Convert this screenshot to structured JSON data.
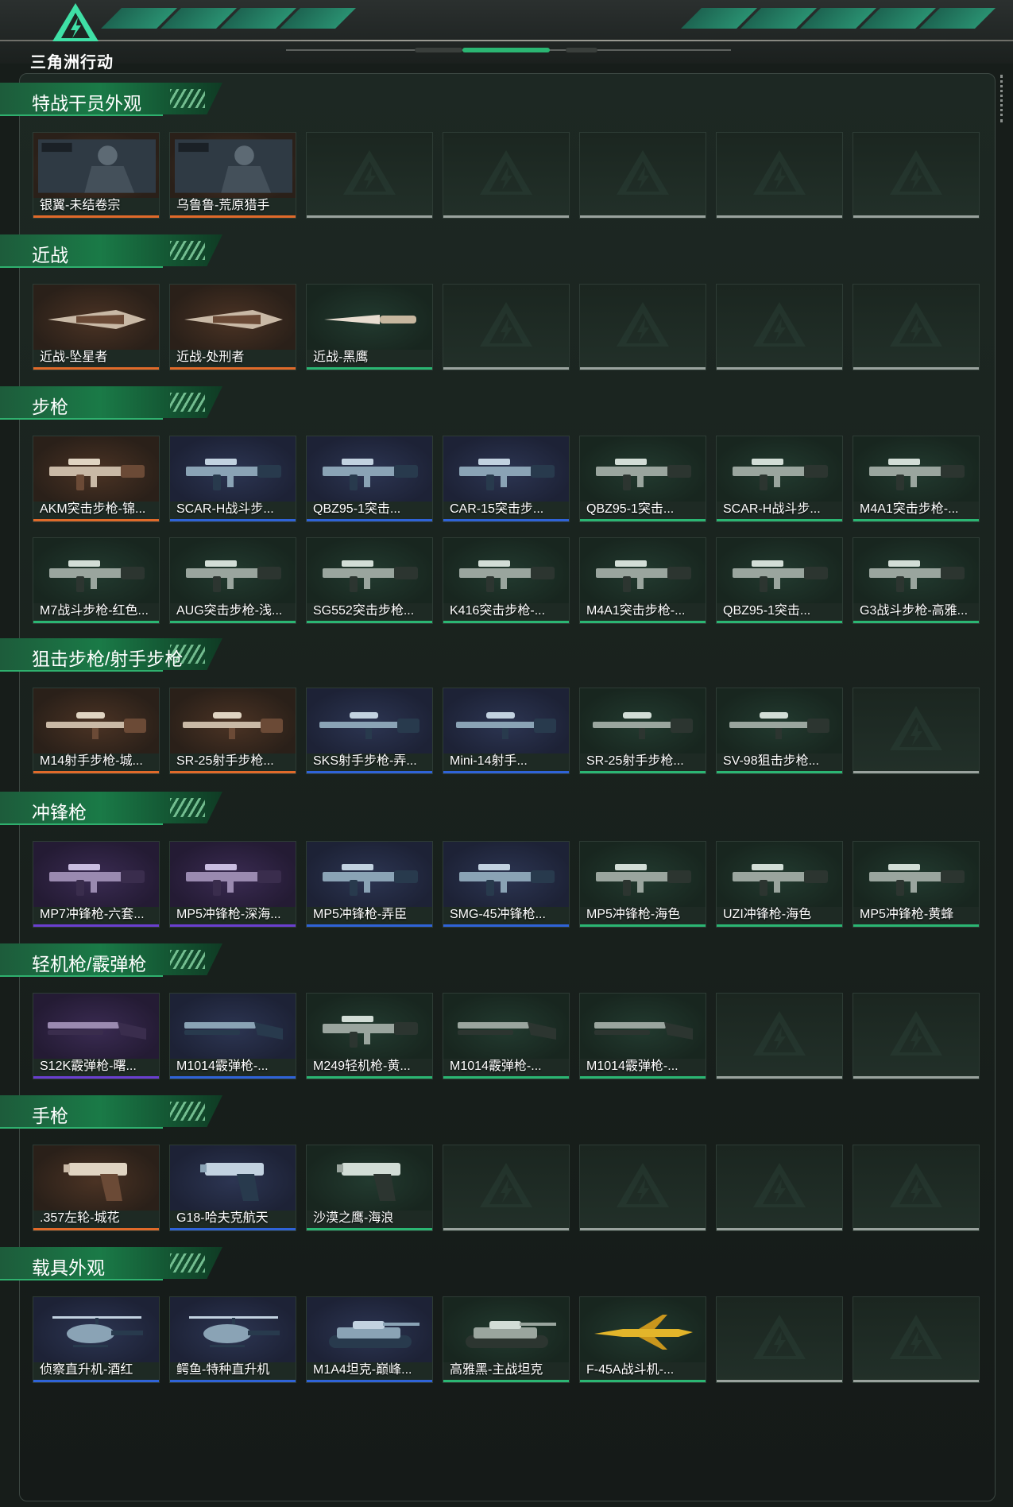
{
  "brand": {
    "logo_text": "三角洲行动"
  },
  "colors": {
    "orange": "#e06a2a",
    "blue": "#2f63d8",
    "purple": "#6a3fd0",
    "green": "#2bb673",
    "empty": "#9aa39e"
  },
  "sections": [
    {
      "title": "特战干员外观",
      "items": [
        {
          "label": "银翼-未结卷宗",
          "tier": "orange",
          "icon": "operator-portrait"
        },
        {
          "label": "乌鲁鲁-荒原猎手",
          "tier": "orange",
          "icon": "operator-portrait"
        },
        {
          "label": "",
          "tier": "empty"
        },
        {
          "label": "",
          "tier": "empty"
        },
        {
          "label": "",
          "tier": "empty"
        },
        {
          "label": "",
          "tier": "empty"
        },
        {
          "label": "",
          "tier": "empty"
        }
      ]
    },
    {
      "title": "近战",
      "items": [
        {
          "label": "近战-坠星者",
          "tier": "orange",
          "icon": "blade"
        },
        {
          "label": "近战-处刑者",
          "tier": "orange",
          "icon": "blade"
        },
        {
          "label": "近战-黑鹰",
          "tier": "green",
          "icon": "knife"
        },
        {
          "label": "",
          "tier": "empty"
        },
        {
          "label": "",
          "tier": "empty"
        },
        {
          "label": "",
          "tier": "empty"
        },
        {
          "label": "",
          "tier": "empty"
        }
      ]
    },
    {
      "title": "步枪",
      "items": [
        {
          "label": "AKM突击步枪-锦...",
          "tier": "orange",
          "icon": "rifle"
        },
        {
          "label": "SCAR-H战斗步...",
          "tier": "blue",
          "icon": "rifle"
        },
        {
          "label": "QBZ95-1突击...",
          "tier": "blue",
          "icon": "rifle"
        },
        {
          "label": "CAR-15突击步...",
          "tier": "blue",
          "icon": "rifle"
        },
        {
          "label": "QBZ95-1突击...",
          "tier": "green",
          "icon": "rifle"
        },
        {
          "label": "SCAR-H战斗步...",
          "tier": "green",
          "icon": "rifle"
        },
        {
          "label": "M4A1突击步枪-...",
          "tier": "green",
          "icon": "rifle"
        },
        {
          "label": "M7战斗步枪-红色...",
          "tier": "green",
          "icon": "rifle"
        },
        {
          "label": "AUG突击步枪-浅...",
          "tier": "green",
          "icon": "rifle"
        },
        {
          "label": "SG552突击步枪...",
          "tier": "green",
          "icon": "rifle"
        },
        {
          "label": "K416突击步枪-...",
          "tier": "green",
          "icon": "rifle"
        },
        {
          "label": "M4A1突击步枪-...",
          "tier": "green",
          "icon": "rifle"
        },
        {
          "label": "QBZ95-1突击...",
          "tier": "green",
          "icon": "rifle"
        },
        {
          "label": "G3战斗步枪-高雅...",
          "tier": "green",
          "icon": "rifle"
        }
      ]
    },
    {
      "title": "狙击步枪/射手步枪",
      "items": [
        {
          "label": "M14射手步枪-城...",
          "tier": "orange",
          "icon": "sniper"
        },
        {
          "label": "SR-25射手步枪...",
          "tier": "orange",
          "icon": "sniper"
        },
        {
          "label": "SKS射手步枪-弄...",
          "tier": "blue",
          "icon": "sniper"
        },
        {
          "label": "Mini-14射手...",
          "tier": "blue",
          "icon": "sniper"
        },
        {
          "label": "SR-25射手步枪...",
          "tier": "green",
          "icon": "sniper"
        },
        {
          "label": "SV-98狙击步枪...",
          "tier": "green",
          "icon": "sniper"
        },
        {
          "label": "",
          "tier": "empty"
        }
      ]
    },
    {
      "title": "冲锋枪",
      "items": [
        {
          "label": "MP7冲锋枪-六套...",
          "tier": "purple",
          "icon": "smg"
        },
        {
          "label": "MP5冲锋枪-深海...",
          "tier": "purple",
          "icon": "smg"
        },
        {
          "label": "MP5冲锋枪-弄臣",
          "tier": "blue",
          "icon": "smg"
        },
        {
          "label": "SMG-45冲锋枪...",
          "tier": "blue",
          "icon": "smg"
        },
        {
          "label": "MP5冲锋枪-海色",
          "tier": "green",
          "icon": "smg"
        },
        {
          "label": "UZI冲锋枪-海色",
          "tier": "green",
          "icon": "smg"
        },
        {
          "label": "MP5冲锋枪-黄蜂",
          "tier": "green",
          "icon": "smg"
        }
      ]
    },
    {
      "title": "轻机枪/霰弹枪",
      "items": [
        {
          "label": "S12K霰弹枪-曙...",
          "tier": "purple",
          "icon": "shotgun"
        },
        {
          "label": "M1014霰弹枪-...",
          "tier": "blue",
          "icon": "shotgun"
        },
        {
          "label": "M249轻机枪-黄...",
          "tier": "green",
          "icon": "lmg"
        },
        {
          "label": "M1014霰弹枪-...",
          "tier": "green",
          "icon": "shotgun"
        },
        {
          "label": "M1014霰弹枪-...",
          "tier": "green",
          "icon": "shotgun"
        },
        {
          "label": "",
          "tier": "empty"
        },
        {
          "label": "",
          "tier": "empty"
        }
      ]
    },
    {
      "title": "手枪",
      "items": [
        {
          "label": ".357左轮-城花",
          "tier": "orange",
          "icon": "pistol"
        },
        {
          "label": "G18-哈夫克航天",
          "tier": "blue",
          "icon": "pistol"
        },
        {
          "label": "沙漠之鹰-海浪",
          "tier": "green",
          "icon": "pistol"
        },
        {
          "label": "",
          "tier": "empty"
        },
        {
          "label": "",
          "tier": "empty"
        },
        {
          "label": "",
          "tier": "empty"
        },
        {
          "label": "",
          "tier": "empty"
        }
      ]
    },
    {
      "title": "载具外观",
      "items": [
        {
          "label": "侦察直升机-酒红",
          "tier": "blue",
          "icon": "helicopter"
        },
        {
          "label": "鳄鱼-特种直升机",
          "tier": "blue",
          "icon": "helicopter"
        },
        {
          "label": "M1A4坦克-巅峰...",
          "tier": "blue",
          "icon": "tank"
        },
        {
          "label": "高雅黑-主战坦克",
          "tier": "green",
          "icon": "tank"
        },
        {
          "label": "F-45A战斗机-...",
          "tier": "green",
          "icon": "jet"
        },
        {
          "label": "",
          "tier": "empty"
        },
        {
          "label": "",
          "tier": "empty"
        }
      ]
    }
  ]
}
